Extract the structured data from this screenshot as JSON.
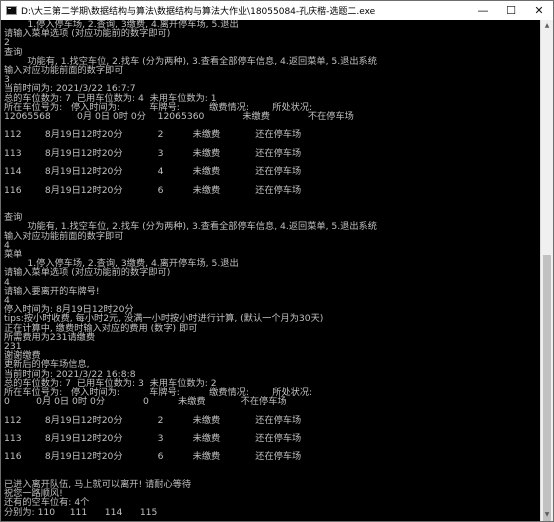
{
  "window": {
    "title": "D:\\大三第二学期\\数据结构与算法\\数据结构与算法大作业\\18055084-孔庆楷-选题二.exe",
    "minimize_glyph": "—",
    "maximize_glyph": "☐",
    "close_glyph": "✕"
  },
  "console": {
    "lines": [
      "        1.停入停车场, 2.查询, 3缴费, 4.离开停车场, 5.退出",
      "请输入菜单选项 (对应功能前的数字即可)",
      "2",
      "查询",
      "        功能有, 1.找空车位, 2.找车 (分为两种), 3.查看全部停车信息, 4.返回菜单, 5.退出系统",
      "输入对应功能前面的数字即可",
      "3",
      "当前时间为: 2021/3/22 16:7:7",
      "总的车位数为: 7  已用车位数为: 4  未用车位数为: 1",
      "所在车位号为:   停入时间为:          车牌号:          缴费情况:        所处状况:",
      "12065568         0月 0日 0时 0分    12065360             未缴费             不在停车场",
      "",
      "112        8月19日12时20分            2          未缴费            还在停车场",
      "",
      "113        8月19日12时20分            3          未缴费            还在停车场",
      "",
      "114        8月19日12时20分            4          未缴费            还在停车场",
      "",
      "116        8月19日12时20分            6          未缴费            还在停车场",
      "",
      "",
      "查询",
      "        功能有, 1.找空车位, 2.找车 (分为两种), 3.查看全部停车信息, 4.返回菜单, 5.退出系统",
      "输入对应功能前面的数字即可",
      "4",
      "菜单",
      "        1.停入停车场, 2.查询, 3缴费, 4.离开停车场, 5.退出",
      "请输入菜单选项 (对应功能前的数字即可)",
      "4",
      "请输入要离开的车牌号!",
      "4",
      "停入时间为: 8月19日12时20分",
      "tips:按小时收费, 每小时2元, 没满一小时按小时进行计算, (默认一个月为30天)",
      "正在计算中, 缴费时输入对应的费用 (数字) 即可",
      "所需费用为231请缴费",
      "231",
      "谢谢缴费",
      "更新后的停车场信息,",
      "当前时间为: 2021/3/22 16:8:8",
      "总的车位数为: 7  已用车位数为: 3  未用车位数为: 2",
      "所在车位号为:   停入时间为:          车牌号:          缴费情况:        所处状况:",
      "0         0月 0日 0时 0分             0          未缴费            不在停车场",
      "",
      "112        8月19日12时20分            2          未缴费            还在停车场",
      "",
      "113        8月19日12时20分            3          未缴费            还在停车场",
      "",
      "116        8月19日12时20分            6          未缴费            还在停车场",
      "",
      "",
      "已进入离开队伍, 马上就可以离开! 请耐心等待",
      "祝您一路顺风!",
      "还有的空车位有: 4个",
      "分别为: 110     111      114      115"
    ]
  }
}
